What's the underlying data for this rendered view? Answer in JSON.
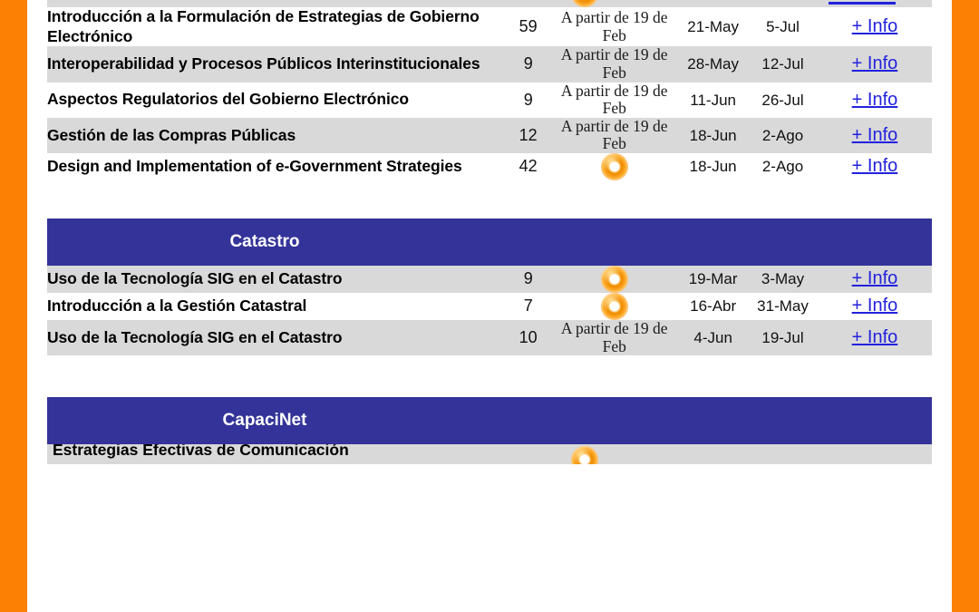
{
  "page": {
    "accent_orange": "#fc8003",
    "header_blue": "#333399",
    "row_alt_gray": "#d9d9d9",
    "link_blue": "#2222dd"
  },
  "top_partial_row": {
    "icon": "orange-disc-icon",
    "info_label": "+ Info"
  },
  "sections": [
    {
      "id": "gobierno-electronico",
      "header": null,
      "rows": [
        {
          "title": "Introducción a la Formulación de Estrategias de Gobierno Electrónico",
          "count": "59",
          "open_text": "A partir de 19 de Feb",
          "open_icon": null,
          "start": "21-May",
          "end": "5-Jul",
          "info": "+ Info",
          "shade": "white"
        },
        {
          "title": "Interoperabilidad y Procesos Públicos Interinstitucionales",
          "count": "9",
          "open_text": "A partir de 19 de Feb",
          "open_icon": null,
          "start": "28-May",
          "end": "12-Jul",
          "info": "+ Info",
          "shade": "gray"
        },
        {
          "title": "Aspectos Regulatorios del Gobierno Electrónico",
          "count": "9",
          "open_text": "A partir de 19 de Feb",
          "open_icon": null,
          "start": "11-Jun",
          "end": "26-Jul",
          "info": "+ Info",
          "shade": "white"
        },
        {
          "title": "Gestión de las Compras Públicas",
          "count": "12",
          "open_text": "A partir de 19 de Feb",
          "open_icon": null,
          "start": "18-Jun",
          "end": "2-Ago",
          "info": "+ Info",
          "shade": "gray"
        },
        {
          "title": "Design and Implementation of e-Government Strategies",
          "count": "42",
          "open_text": "",
          "open_icon": "orange-disc-icon",
          "start": "18-Jun",
          "end": "2-Ago",
          "info": "+ Info",
          "shade": "white"
        }
      ]
    },
    {
      "id": "catastro",
      "header": "Catastro",
      "rows": [
        {
          "title": "Uso de la Tecnología SIG en el Catastro",
          "count": "9",
          "open_text": "",
          "open_icon": "orange-disc-icon",
          "start": "19-Mar",
          "end": "3-May",
          "info": "+ Info",
          "shade": "gray"
        },
        {
          "title": "Introducción a la Gestión Catastral",
          "count": "7",
          "open_text": "",
          "open_icon": "orange-disc-icon",
          "start": "16-Abr",
          "end": "31-May",
          "info": "+ Info",
          "shade": "white"
        },
        {
          "title": "Uso de la Tecnología SIG en el Catastro",
          "count": "10",
          "open_text": "A partir de 19 de Feb",
          "open_icon": null,
          "start": "4-Jun",
          "end": "19-Jul",
          "info": "+ Info",
          "shade": "gray"
        }
      ]
    },
    {
      "id": "capacinet",
      "header": "CapaciNet",
      "rows": []
    }
  ],
  "bottom_partial_row": {
    "title": "Estrategias Efectivas de Comunicación",
    "icon": "orange-disc-icon"
  }
}
